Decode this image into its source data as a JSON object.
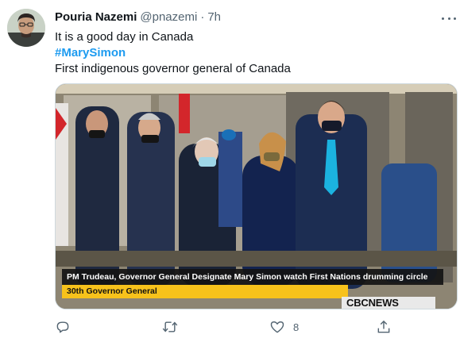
{
  "tweet": {
    "author_name": "Pouria Nazemi",
    "handle": "@pnazemi",
    "separator": "·",
    "time": "7h",
    "lines": [
      "It is a good day in Canada",
      "#MarySimon",
      "First indigenous governor general of Canada"
    ]
  },
  "media": {
    "chyron_headline": "PM Trudeau, Governor General Designate Mary Simon watch First Nations drumming circle",
    "chyron_sub": "30th Governor General",
    "network_logo": "CBCNEWS"
  },
  "actions": {
    "reply_count": "",
    "retweet_count": "",
    "like_count": "8",
    "share_count": ""
  },
  "icons": {
    "reply": "reply-icon",
    "retweet": "retweet-icon",
    "like": "heart-icon",
    "share": "share-icon",
    "more": "more-icon"
  },
  "colors": {
    "accent": "#1d9bf0",
    "secondary_text": "#536471",
    "chyron_yellow": "#f7c21b"
  }
}
